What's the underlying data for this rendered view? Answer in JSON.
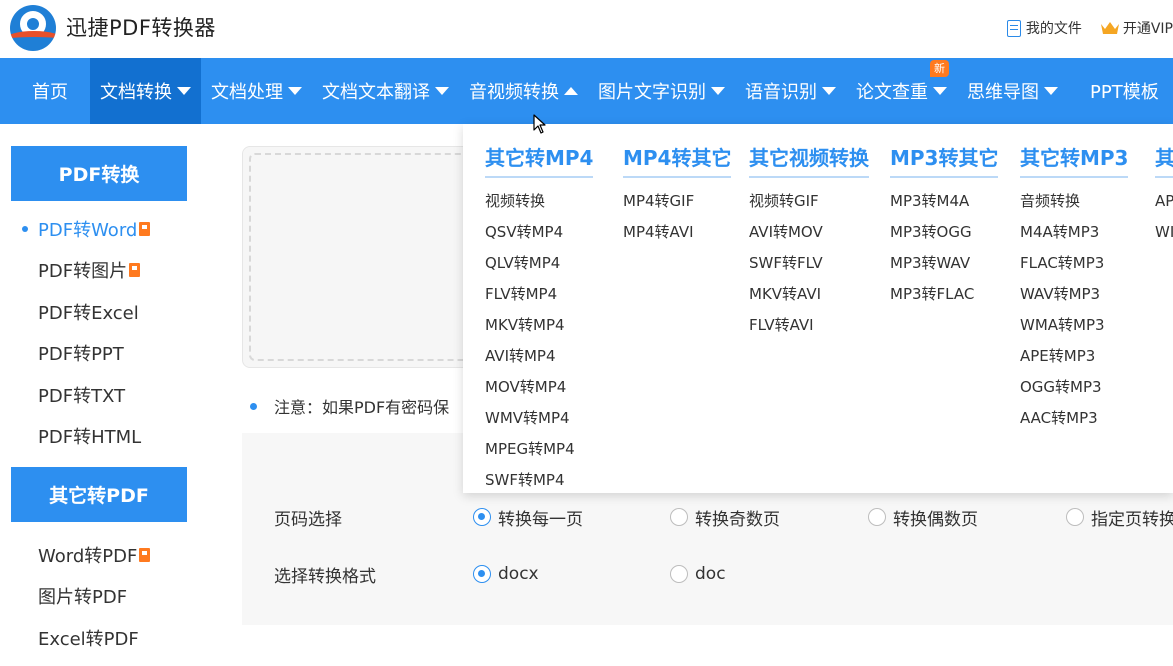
{
  "header": {
    "brand": "迅捷PDF转换器",
    "my_files": "我的文件",
    "vip": "开通VIP"
  },
  "nav": {
    "items": [
      {
        "label": "首页"
      },
      {
        "label": "文档转换"
      },
      {
        "label": "文档处理"
      },
      {
        "label": "文档文本翻译"
      },
      {
        "label": "音视频转换"
      },
      {
        "label": "图片文字识别"
      },
      {
        "label": "语音识别"
      },
      {
        "label": "论文查重"
      },
      {
        "label": "思维导图"
      },
      {
        "label": "PPT模板"
      }
    ],
    "new_badge": "新"
  },
  "sidebar": {
    "sections": [
      {
        "title": "PDF转换",
        "items": [
          "PDF转Word",
          "PDF转图片",
          "PDF转Excel",
          "PDF转PPT",
          "PDF转TXT",
          "PDF转HTML"
        ]
      },
      {
        "title": "其它转PDF",
        "items": [
          "Word转PDF",
          "图片转PDF",
          "Excel转PDF"
        ]
      }
    ]
  },
  "main": {
    "note": "注意：如果PDF有密码保",
    "page_select_label": "页码选择",
    "page_options": [
      "转换每一页",
      "转换奇数页",
      "转换偶数页",
      "指定页转换"
    ],
    "format_label": "选择转换格式",
    "format_options": [
      "docx",
      "doc"
    ]
  },
  "dropdown": {
    "columns": [
      {
        "title": "其它转MP4",
        "items": [
          "视频转换",
          "QSV转MP4",
          "QLV转MP4",
          "FLV转MP4",
          "MKV转MP4",
          "AVI转MP4",
          "MOV转MP4",
          "WMV转MP4",
          "MPEG转MP4",
          "SWF转MP4"
        ]
      },
      {
        "title": "MP4转其它",
        "items": [
          "MP4转GIF",
          "MP4转AVI"
        ]
      },
      {
        "title": "其它视频转换",
        "items": [
          "视频转GIF",
          "AVI转MOV",
          "SWF转FLV",
          "MKV转AVI",
          "FLV转AVI"
        ]
      },
      {
        "title": "MP3转其它",
        "items": [
          "MP3转M4A",
          "MP3转OGG",
          "MP3转WAV",
          "MP3转FLAC"
        ]
      },
      {
        "title": "其它转MP3",
        "items": [
          "音频转换",
          "M4A转MP3",
          "FLAC转MP3",
          "WAV转MP3",
          "WMA转MP3",
          "APE转MP3",
          "OGG转MP3",
          "AAC转MP3"
        ]
      },
      {
        "title": "其",
        "items": [
          "AP",
          "WI"
        ]
      }
    ]
  },
  "colors": {
    "accent": "#2d8ff0",
    "nav_active": "#1270d0",
    "badge": "#ff7a1f"
  }
}
